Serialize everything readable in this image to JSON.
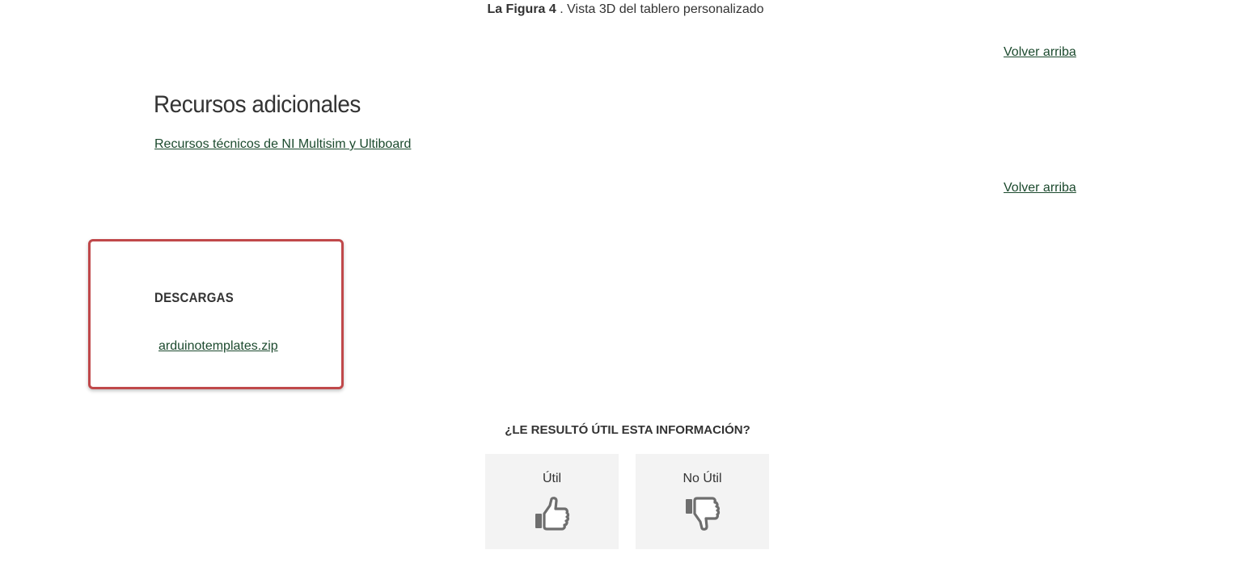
{
  "figure_caption": {
    "label": "La Figura 4",
    "text": " . Vista 3D del tablero personalizado"
  },
  "back_to_top": {
    "label_1": "Volver arriba",
    "label_2": "Volver arriba"
  },
  "additional_resources": {
    "title": "Recursos adicionales",
    "link_label": "Recursos técnicos de NI Multisim y Ultiboard"
  },
  "downloads": {
    "heading": "DESCARGAS",
    "file_name": "arduinotemplates.zip",
    "highlight_color": "#c0484a"
  },
  "feedback": {
    "question": "¿LE RESULTÓ ÚTIL ESTA INFORMACIÓN?",
    "useful_label": "Útil",
    "not_useful_label": "No Útil",
    "useful_icon": "thumbs-up-icon",
    "not_useful_icon": "thumbs-down-icon"
  },
  "colors": {
    "link": "#1c4a2e",
    "text": "#333333",
    "button_bg": "#f3f3f3"
  }
}
